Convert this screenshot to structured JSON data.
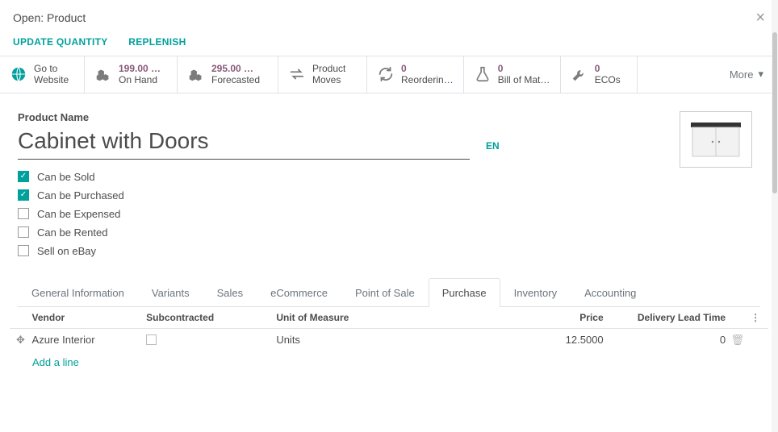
{
  "modal": {
    "title": "Open: Product"
  },
  "actions": {
    "update_qty": "UPDATE QUANTITY",
    "replenish": "REPLENISH"
  },
  "stats": {
    "goto": {
      "line1": "Go to",
      "line2": "Website"
    },
    "onhand": {
      "value": "199.00 …",
      "label": "On Hand"
    },
    "forecast": {
      "value": "295.00 …",
      "label": "Forecasted"
    },
    "moves": {
      "line1": "Product",
      "line2": "Moves"
    },
    "reorder": {
      "value": "0",
      "label": "Reorderin…"
    },
    "bom": {
      "value": "0",
      "label": "Bill of Mat…"
    },
    "eco": {
      "value": "0",
      "label": "ECOs"
    },
    "more": "More"
  },
  "product": {
    "name_label": "Product Name",
    "name": "Cabinet with Doors",
    "lang": "EN"
  },
  "checks": [
    {
      "label": "Can be Sold",
      "checked": true
    },
    {
      "label": "Can be Purchased",
      "checked": true
    },
    {
      "label": "Can be Expensed",
      "checked": false
    },
    {
      "label": "Can be Rented",
      "checked": false
    },
    {
      "label": "Sell on eBay",
      "checked": false
    }
  ],
  "tabs": [
    "General Information",
    "Variants",
    "Sales",
    "eCommerce",
    "Point of Sale",
    "Purchase",
    "Inventory",
    "Accounting"
  ],
  "active_tab": 5,
  "table": {
    "headers": {
      "vendor": "Vendor",
      "sub": "Subcontracted",
      "uom": "Unit of Measure",
      "price": "Price",
      "dlt": "Delivery Lead Time"
    },
    "rows": [
      {
        "vendor": "Azure Interior",
        "sub": false,
        "uom": "Units",
        "price": "12.5000",
        "dlt": "0"
      }
    ],
    "add": "Add a line"
  }
}
